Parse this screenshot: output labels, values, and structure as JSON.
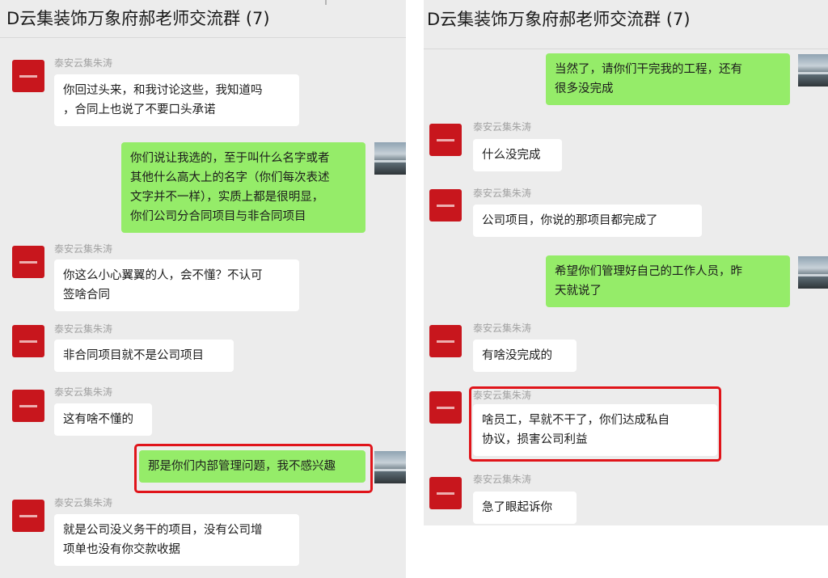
{
  "left": {
    "title": "D云集装饰万象府郝老师交流群 (7)",
    "messages": [
      {
        "side": "in",
        "sender": "泰安云集朱涛",
        "text": "你回过头来，和我讨论这些，我知道吗\n，合同上也说了不要口头承诺"
      },
      {
        "side": "out",
        "text": "你们说让我选的，至于叫什么名字或者\n其他什么高大上的名字（你们每次表述\n文字并不一样），实质上都是很明显，\n你们公司分合同项目与非合同项目"
      },
      {
        "side": "in",
        "sender": "泰安云集朱涛",
        "text": "你这么小心翼翼的人，会不懂？不认可\n签啥合同"
      },
      {
        "side": "in",
        "sender": "泰安云集朱涛",
        "text": "非合同项目就不是公司项目"
      },
      {
        "side": "in",
        "sender": "泰安云集朱涛",
        "text": "这有啥不懂的"
      },
      {
        "side": "out",
        "text": "那是你们内部管理问题，我不感兴趣",
        "highlighted": true
      },
      {
        "side": "in",
        "sender": "泰安云集朱涛",
        "text": "就是公司没义务干的项目，没有公司增\n项单也没有你交款收据"
      }
    ]
  },
  "right": {
    "title": "D云集装饰万象府郝老师交流群 (7)",
    "messages": [
      {
        "side": "out",
        "text": "当然了，请你们干完我的工程，还有\n很多没完成"
      },
      {
        "side": "in",
        "sender": "泰安云集朱涛",
        "text": "什么没完成"
      },
      {
        "side": "in",
        "sender": "泰安云集朱涛",
        "text": "公司项目，你说的那项目都完成了"
      },
      {
        "side": "out",
        "text": "希望你们管理好自己的工作人员，昨\n天就说了"
      },
      {
        "side": "in",
        "sender": "泰安云集朱涛",
        "text": "有啥没完成的"
      },
      {
        "side": "in",
        "sender": "泰安云集朱涛",
        "text": "啥员工，早就不干了，你们达成私自\n协议，损害公司利益",
        "highlighted": true
      },
      {
        "side": "in",
        "sender": "泰安云集朱涛",
        "text": "急了眼起诉你"
      }
    ]
  },
  "colors": {
    "outgoing_bubble": "#95ec69",
    "incoming_bubble": "#ffffff",
    "highlight": "#e0141a",
    "avatar_brand": "#c8161d"
  },
  "icons": {
    "incoming_avatar": "company-logo-avatar-icon",
    "outgoing_avatar": "landscape-photo-avatar-icon"
  }
}
